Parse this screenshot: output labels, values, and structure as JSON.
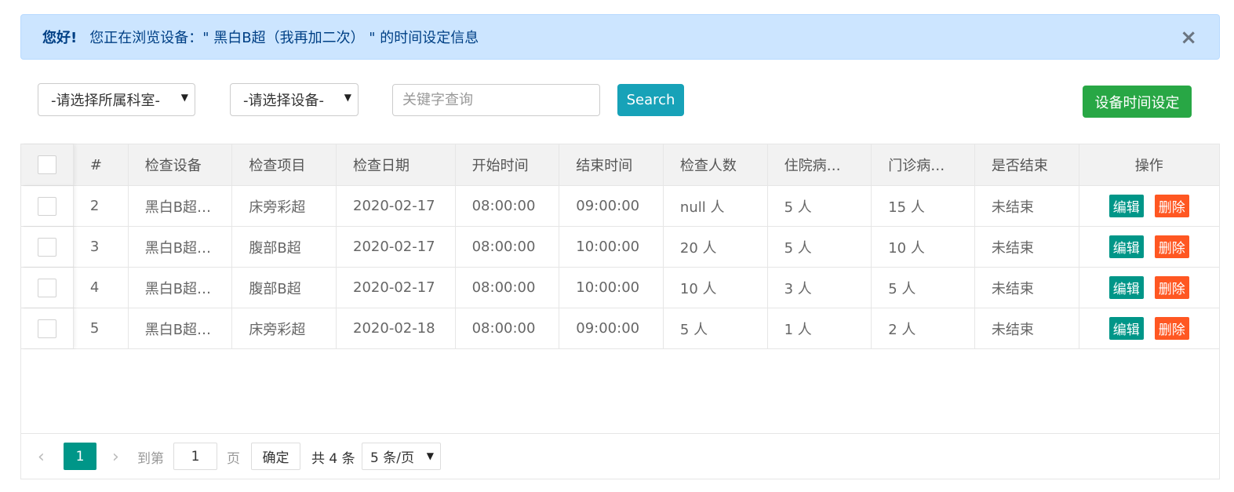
{
  "alert": {
    "strong": "您好!",
    "message": "您正在浏览设备：\" 黑白B超（我再加二次） \" 的时间设定信息",
    "close_glyph": "×"
  },
  "filters": {
    "department_select": "-请选择所属科室-",
    "device_select": "-请选择设备-",
    "search_placeholder": "关键字查询",
    "search_button": "Search",
    "setting_button": "设备时间设定",
    "arrow_glyph": "▼"
  },
  "table": {
    "headers": [
      "#",
      "检查设备",
      "检查项目",
      "检查日期",
      "开始时间",
      "结束时间",
      "检查人数",
      "住院病…",
      "门诊病…",
      "是否结束",
      "操作"
    ],
    "edit_label": "编辑",
    "delete_label": "删除",
    "rows": [
      [
        "2",
        "黑白B超…",
        "床旁彩超",
        "2020-02-17",
        "08:00:00",
        "09:00:00",
        "null 人",
        "5 人",
        "15 人",
        "未结束"
      ],
      [
        "3",
        "黑白B超…",
        "腹部B超",
        "2020-02-17",
        "08:00:00",
        "10:00:00",
        "20 人",
        "5 人",
        "10 人",
        "未结束"
      ],
      [
        "4",
        "黑白B超…",
        "腹部B超",
        "2020-02-17",
        "08:00:00",
        "10:00:00",
        "10 人",
        "3 人",
        "5 人",
        "未结束"
      ],
      [
        "5",
        "黑白B超…",
        "床旁彩超",
        "2020-02-18",
        "08:00:00",
        "09:00:00",
        "5 人",
        "1 人",
        "2 人",
        "未结束"
      ]
    ]
  },
  "pagination": {
    "prev_glyph": "‹",
    "next_glyph": "›",
    "current_page": "1",
    "goto_label": "到第",
    "goto_value": "1",
    "page_unit": "页",
    "confirm_label": "确定",
    "total_label": "共 4 条",
    "page_size": "5 条/页"
  },
  "colors": {
    "alert_bg": "#cce5ff",
    "search_button": "#17a2b8",
    "setting_button": "#28a745",
    "edit_button": "#009688",
    "delete_button": "#ff5722",
    "current_page": "#009688"
  }
}
